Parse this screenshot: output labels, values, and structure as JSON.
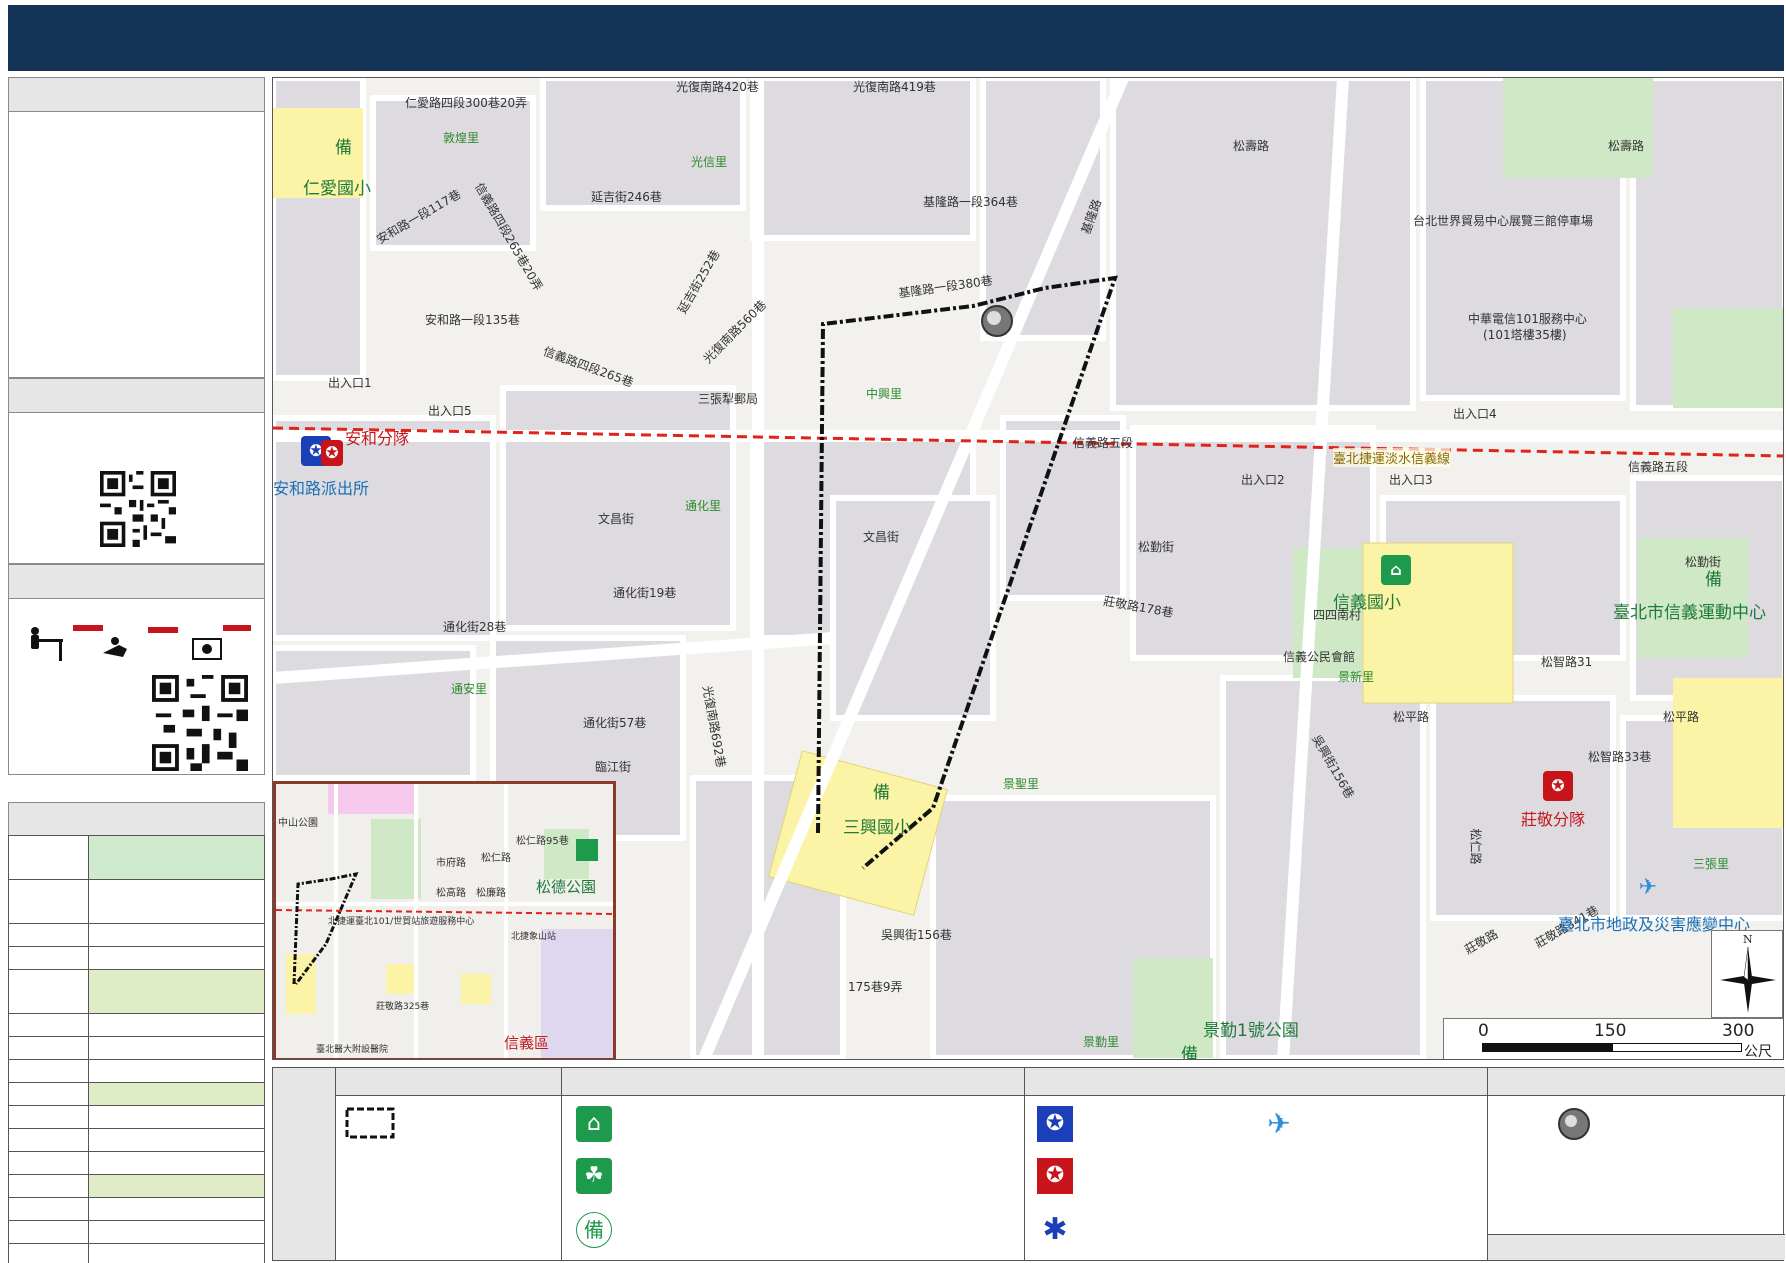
{
  "map_labels": {
    "rd_renai": "仁愛路四段300巷20弄",
    "rd_guangfu_s420": "光復南路420巷",
    "rd_guangfu_s419": "光復南路419巷",
    "rd_songshou": "松壽路",
    "rd_songgao": "松高路",
    "rd_keelung1": "基隆路一段364巷",
    "rd_keelung380": "基隆路一段380巷",
    "rd_yanji246": "延吉街246巷",
    "rd_anhe117": "安和路一段117巷",
    "rd_anhe135": "安和路一段135巷",
    "rd_xinyi265_20": "信義路四段265巷20弄",
    "rd_xinyi265": "信義路四段265巷",
    "rd_yanji252": "延吉街252巷",
    "rd_guangfu560": "光復南路560巷",
    "rd_xinyi5": "信義路五段",
    "rd_wenchang": "文昌街",
    "rd_tonghua19": "通化街19巷",
    "rd_tonghua28": "通化街28巷",
    "rd_tonghua57": "通化街57巷",
    "rd_linjiang": "臨江街",
    "rd_wuxing156": "吳興街156巷",
    "rd_zhuangjing178": "莊敬路178巷",
    "rd_songqin": "松勤街",
    "rd_songzhi31": "松智路31",
    "rd_songping": "松平路",
    "rd_songzhi33": "松智路33巷",
    "rd_zhuangjing341": "莊敬路341巷",
    "rd_zhuangjing": "莊敬路",
    "rd_175": "175巷9弄",
    "rd_lane_guangfu692": "光復南路692巷",
    "rd_songren": "松仁路",
    "rd_keelung": "基隆路",
    "pl_renai_es": "仁愛國小",
    "pl_anhe_police": "安和路派出所",
    "pl_anhe_squad": "安和分隊",
    "pl_xinyi_es": "信義國小",
    "pl_sanxing_es": "三興國小",
    "pl_zhuangjing_squad": "莊敬分隊",
    "pl_sports_center": "臺北市信義運動中心",
    "pl_disaster_center": "臺北市地政及災害應變中心",
    "pl_park1": "景勤1號公園",
    "pl_metro_line": "臺北捷運淡水信義線",
    "pl_wtc": "台北世界貿易中心展覽三館停車場",
    "pl_cht101": "中華電信101服務中心",
    "pl_101": "(101塔樓35樓)",
    "pl_sanzhang": "三張犁郵局",
    "pl_sanzhang_li": "三張里",
    "pl_jingxin_li": "景新里",
    "pl_jingsheng_li": "景聖里",
    "pl_jingqin_li": "景勤里",
    "pl_zhonghsing_li": "中興里",
    "pl_tonghua_li": "通化里",
    "pl_tongan_li": "通安里",
    "pl_guangxin_li": "光信里",
    "pl_dunhua_li": "敦煌里",
    "pl_sijin": "四四南村",
    "pl_community": "信義公民會館",
    "pl_exit1": "出入口1",
    "pl_exit2": "出入口2",
    "pl_exit3": "出入口3",
    "pl_exit4": "出入口4",
    "pl_exit5": "出入口5",
    "pl_bei": "備",
    "pl_hospital": "臺北醫大附設醫院"
  },
  "inset_labels": {
    "zhongshan_park": "中山公園",
    "songde_park": "松德公園",
    "xinyi_district": "信義區",
    "songren95": "松仁路95巷",
    "songgao": "松高路",
    "songren": "松仁路",
    "songlian": "松廉路",
    "shifu": "市府路",
    "metro": "北捷運臺北101/世貿站旅遊服務中心",
    "hospital": "臺北醫大附設醫院",
    "xiangshan": "北捷象山站",
    "zhuangjing325": "莊敬路325巷"
  },
  "scale": {
    "tick_0": "0",
    "tick_150": "150",
    "tick_300": "300",
    "unit": "公尺"
  },
  "north": "N",
  "colors": {
    "header": "#123356",
    "metro_line": "#e0231c",
    "route": "#111111",
    "school_fill": "#fbf3a6",
    "park_fill": "#cfe8c5",
    "police_blue": "#1b3fb8",
    "fire_red": "#c7141a",
    "emergency_blue": "#2f8fd8",
    "shelter_green": "#1d9a4c"
  },
  "legend_icons": [
    "route-boundary-icon",
    "shelter-icon",
    "evacuation-park-icon",
    "backup-shelter-icon",
    "police-icon",
    "fire-squad-icon",
    "medical-icon",
    "helicopter-icon",
    "site-marker-icon"
  ]
}
